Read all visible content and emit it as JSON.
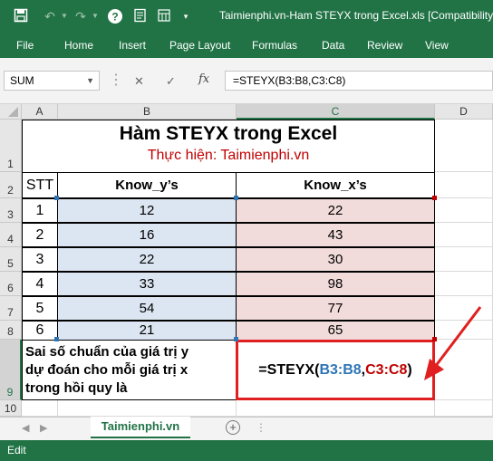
{
  "titlebar": {
    "doc_title": "Taimienphi.vn-Ham STEYX trong Excel.xls [Compatibility",
    "icons": [
      "save-icon",
      "undo-icon",
      "undo-dropdown-icon",
      "redo-icon",
      "redo-dropdown-icon",
      "help-icon",
      "print-preview-icon",
      "customize-qat-icon"
    ]
  },
  "ribbon": {
    "tabs": [
      "File",
      "Home",
      "Insert",
      "Page Layout",
      "Formulas",
      "Data",
      "Review",
      "View"
    ]
  },
  "formula_bar": {
    "name_box": "SUM",
    "formula": "=STEYX(B3:B8,C3:C8)",
    "cancel_symbol": "✕",
    "enter_symbol": "✓",
    "fx_symbol": "fx"
  },
  "sheet": {
    "columns": [
      "A",
      "B",
      "C",
      "D"
    ],
    "selected_column": "C",
    "row_numbers": [
      "1",
      "2",
      "3",
      "4",
      "5",
      "6",
      "7",
      "8",
      "9",
      "10"
    ],
    "selected_row": "9",
    "title": "Hàm STEYX trong Excel",
    "subtitle": "Thực hiện: Taimienphi.vn",
    "headers": [
      "STT",
      "Know_y’s",
      "Know_x’s"
    ],
    "rows": [
      {
        "stt": "1",
        "y": "12",
        "x": "22"
      },
      {
        "stt": "2",
        "y": "16",
        "x": "43"
      },
      {
        "stt": "3",
        "y": "22",
        "x": "30"
      },
      {
        "stt": "4",
        "y": "33",
        "x": "98"
      },
      {
        "stt": "5",
        "y": "54",
        "x": "77"
      },
      {
        "stt": "6",
        "y": "21",
        "x": "65"
      }
    ],
    "description": [
      "Sai số chuẩn của giá trị y",
      "dự đoán cho mỗi giá trị x",
      "trong hồi quy là"
    ],
    "edit_formula": {
      "prefix": "=STEYX(",
      "ref1": "B3:B8",
      "sep": ",",
      "ref2": "C3:C8",
      "suffix": ")"
    }
  },
  "sheet_tabs": {
    "active": "Taimienphi.vn",
    "add_symbol": "+"
  },
  "status": {
    "mode": "Edit"
  },
  "colors": {
    "excel_green": "#217346",
    "ref_blue": "#2e75b6",
    "ref_red": "#c00000",
    "annotation_red": "#e02020"
  }
}
